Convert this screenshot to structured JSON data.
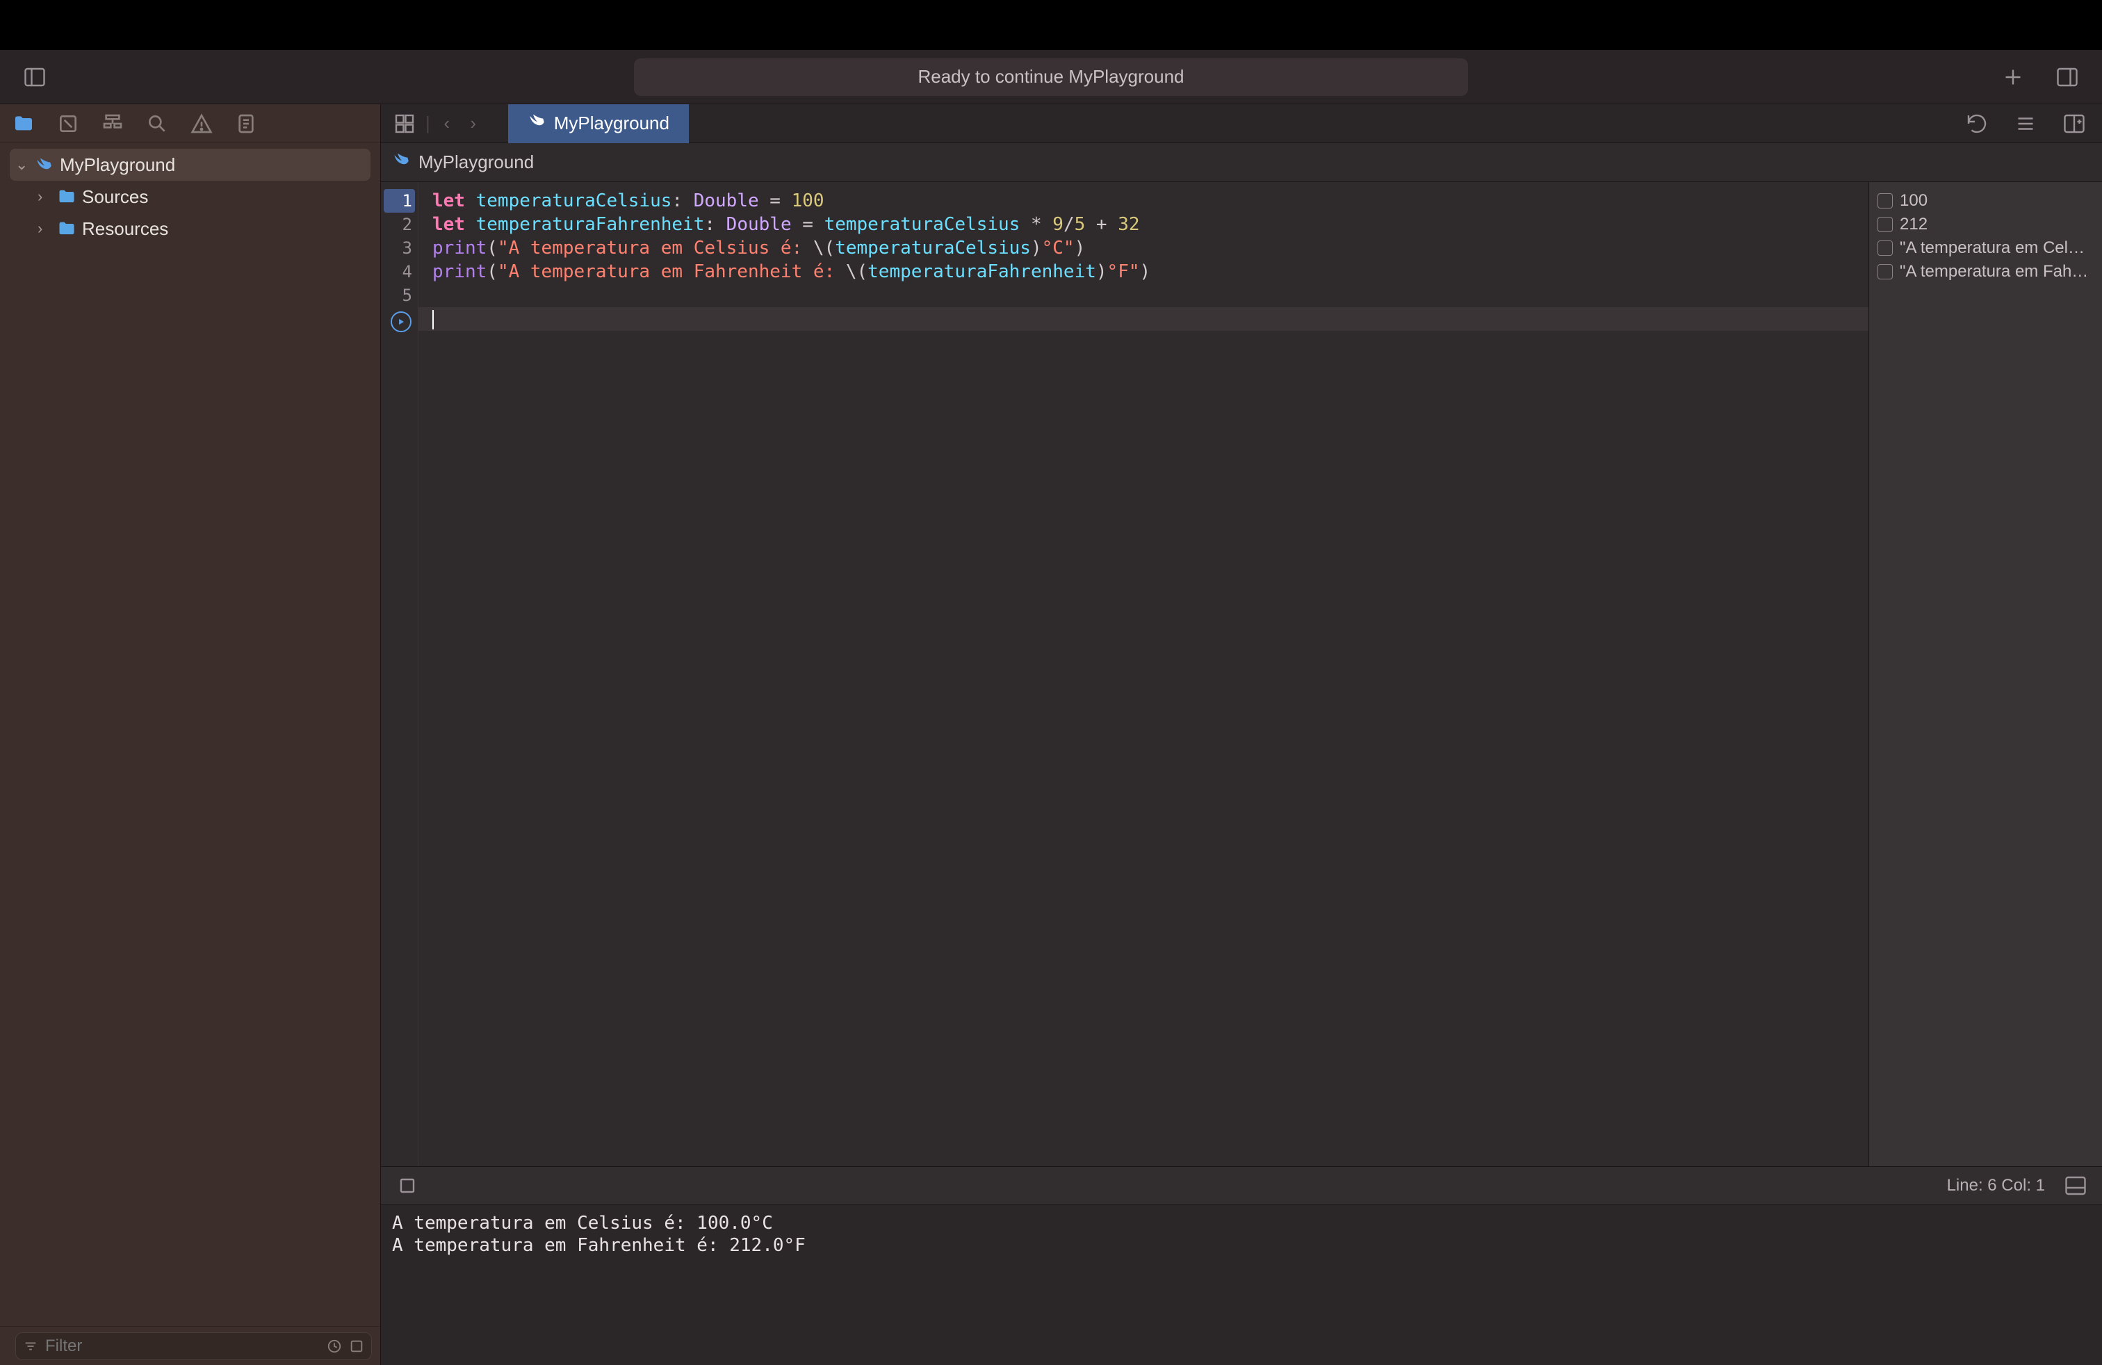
{
  "titlebar": {
    "status": "Ready to continue MyPlayground"
  },
  "sidebar": {
    "project": "MyPlayground",
    "children": [
      {
        "label": "Sources"
      },
      {
        "label": "Resources"
      }
    ],
    "filter_placeholder": "Filter"
  },
  "tab": {
    "label": "MyPlayground"
  },
  "breadcrumb": {
    "label": "MyPlayground"
  },
  "code": {
    "lines": [
      "1",
      "2",
      "3",
      "4",
      "5"
    ],
    "l1": {
      "kw": "let",
      "id": "temperaturaCelsius",
      "ty": "Double",
      "eq": "=",
      "num": "100",
      "colon": ": "
    },
    "l2": {
      "kw": "let",
      "id": "temperaturaFahrenheit",
      "ty": "Double",
      "eq": "=",
      "expr_id": "temperaturaCelsius",
      "op1": " * ",
      "n1": "9",
      "slash": "/",
      "n2": "5",
      "plus": " + ",
      "n3": "32",
      "colon": ": "
    },
    "l3": {
      "fn": "print",
      "open": "(",
      "s1": "\"A temperatura em Celsius é: ",
      "bs": "\\(",
      "int": "temperaturaCelsius",
      "cb": ")",
      "s2": "°C\"",
      ")": ")"
    },
    "l4": {
      "fn": "print",
      "open": "(",
      "s1": "\"A temperatura em Fahrenheit é: ",
      "bs": "\\(",
      "int": "temperaturaFahrenheit",
      "cb": ")",
      "s2": "°F\"",
      ")": ")"
    }
  },
  "results": [
    {
      "text": "100"
    },
    {
      "text": "212"
    },
    {
      "text": "\"A temperatura em Cel…"
    },
    {
      "text": "\"A temperatura em Fah…"
    }
  ],
  "statusbar": {
    "line_col": "Line: 6  Col: 1"
  },
  "console": {
    "lines": [
      "A temperatura em Celsius é: 100.0°C",
      "A temperatura em Fahrenheit é: 212.0°F"
    ]
  }
}
